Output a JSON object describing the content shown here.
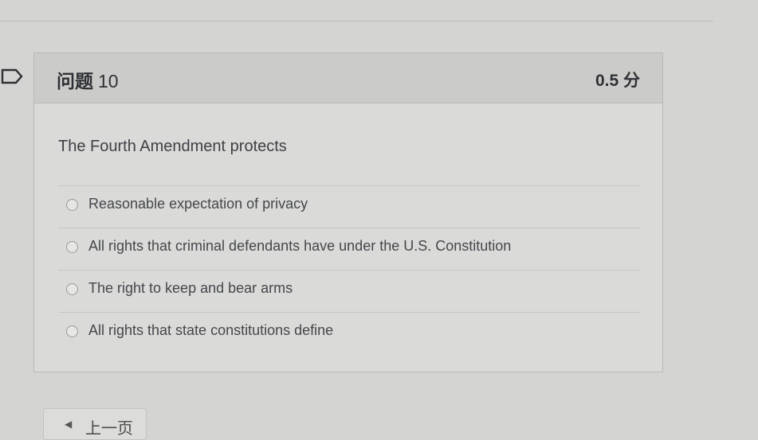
{
  "question": {
    "title": "问题",
    "number": "10",
    "points": "0.5 分",
    "text": "The Fourth Amendment protects",
    "answers": [
      {
        "label": "Reasonable expectation of privacy",
        "selected": false
      },
      {
        "label": "All rights that criminal defendants have under the U.S. Constitution",
        "selected": false
      },
      {
        "label": "The right to keep and bear arms",
        "selected": false
      },
      {
        "label": "All rights that state constitutions define",
        "selected": false
      }
    ]
  },
  "navigation": {
    "prev_label": "上一页",
    "prev_icon": "triangle-left-icon"
  },
  "icons": {
    "flag": "flag-outline-icon"
  }
}
